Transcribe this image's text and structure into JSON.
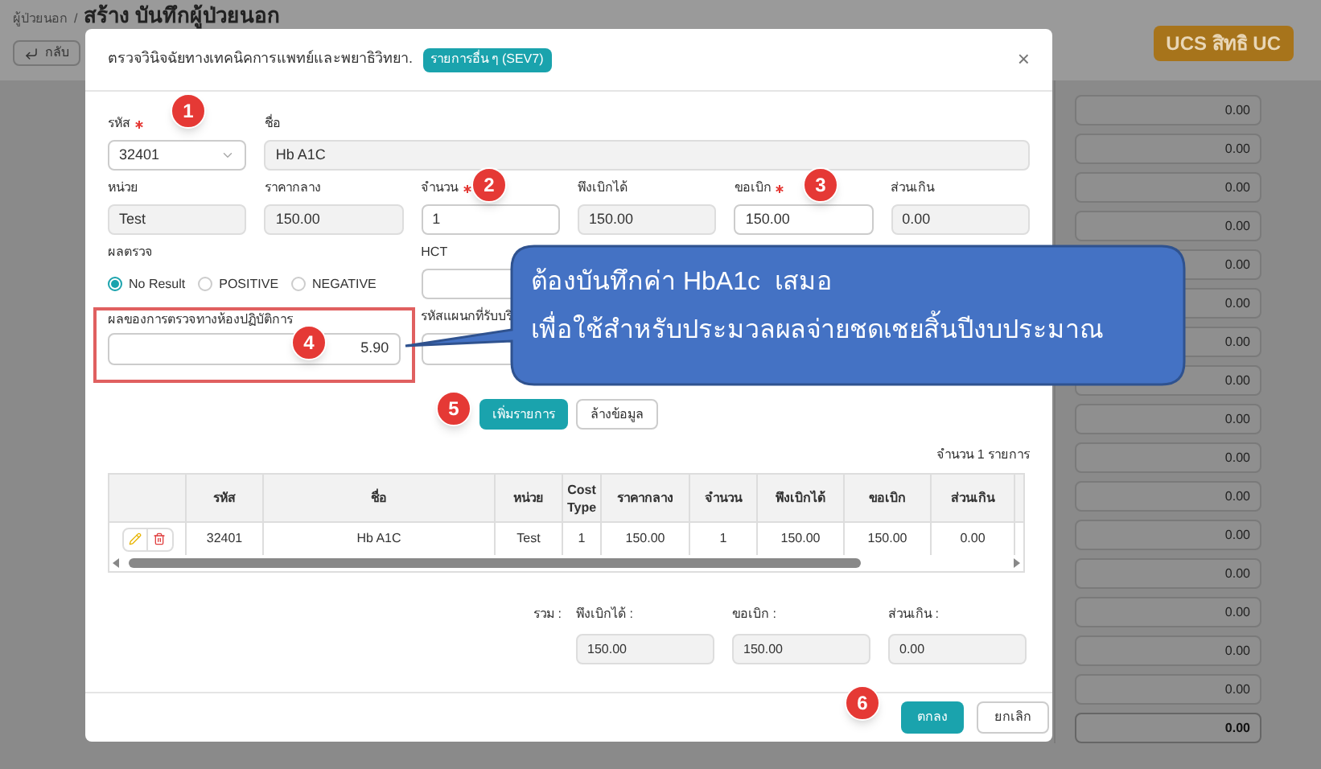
{
  "page": {
    "breadcrumb": "ผู้ป่วยนอก",
    "separator": "/",
    "title": "สร้าง บันทึกผู้ป่วยนอก",
    "back_button": "กลับ",
    "badge": "UCS สิทธิ UC",
    "amounts": [
      "0.00",
      "0.00",
      "0.00",
      "0.00",
      "0.00",
      "0.00",
      "0.00",
      "0.00",
      "0.00",
      "0.00",
      "0.00",
      "0.00",
      "0.00",
      "0.00",
      "0.00",
      "0.00"
    ],
    "total": "0.00"
  },
  "modal": {
    "title": "ตรวจวินิจฉัยทางเทคนิคการแพทย์และพยาธิวิทยา.",
    "tag": "รายการอื่น ๆ (SEV7)",
    "close": "×",
    "code": {
      "label": "รหัส",
      "required": true,
      "value": "32401"
    },
    "name": {
      "label": "ชื่อ",
      "required": false,
      "value": "Hb A1C",
      "disabled": true
    },
    "fields": [
      {
        "label": "หน่วย",
        "required": false,
        "value": "Test",
        "disabled": true
      },
      {
        "label": "ราคากลาง",
        "required": false,
        "value": "150.00",
        "disabled": true
      },
      {
        "label": "จำนวน",
        "required": true,
        "value": "1",
        "disabled": false
      },
      {
        "label": "พึงเบิกได้",
        "required": false,
        "value": "150.00",
        "disabled": true
      },
      {
        "label": "ขอเบิก",
        "required": true,
        "value": "150.00",
        "disabled": false
      },
      {
        "label": "ส่วนเกิน",
        "required": false,
        "value": "0.00",
        "disabled": true
      }
    ],
    "result": {
      "label": "ผลตรวจ",
      "options": [
        {
          "label": "No Result",
          "selected": true
        },
        {
          "label": "POSITIVE",
          "selected": false
        },
        {
          "label": "NEGATIVE",
          "selected": false
        }
      ]
    },
    "hct": {
      "label": "HCT"
    },
    "lab_result": {
      "label": "ผลของการตรวจทางห้องปฏิบัติการ",
      "value": "5.90",
      "highlighted": true
    },
    "dept_code": {
      "label": "รหัสแผนกที่รับบริ"
    },
    "add_button": "เพิ่มรายการ",
    "clear_button": "ล้างข้อมูล",
    "count": "จำนวน 1 รายการ",
    "table": {
      "columns": [
        "รหัส",
        "ชื่อ",
        "หน่วย",
        "Cost Type",
        "ราคากลาง",
        "จำนวน",
        "พึงเบิกได้",
        "ขอเบิก",
        "ส่วนเกิน"
      ],
      "rows": [
        {
          "cells": [
            "32401",
            "Hb A1C",
            "Test",
            "1",
            "150.00",
            "1",
            "150.00",
            "150.00",
            "0.00"
          ]
        }
      ]
    },
    "totals": {
      "label": "รวม :",
      "items": [
        {
          "label": "พึงเบิกได้ :",
          "value": "150.00"
        },
        {
          "label": "ขอเบิก :",
          "value": "150.00"
        },
        {
          "label": "ส่วนเกิน :",
          "value": "0.00"
        }
      ]
    },
    "ok_button": "ตกลง",
    "cancel_button": "ยกเลิก"
  },
  "callout": {
    "lines": [
      "ต้องบันทึกค่า HbA1c  เสมอ",
      "เพื่อใช้สำหรับประมวลผลจ่ายชดเชยสิ้นปีงบประมาณ"
    ]
  },
  "markers": [
    {
      "label": "1"
    },
    {
      "label": "2"
    },
    {
      "label": "3"
    },
    {
      "label": "4"
    },
    {
      "label": "5"
    },
    {
      "label": "6"
    }
  ]
}
